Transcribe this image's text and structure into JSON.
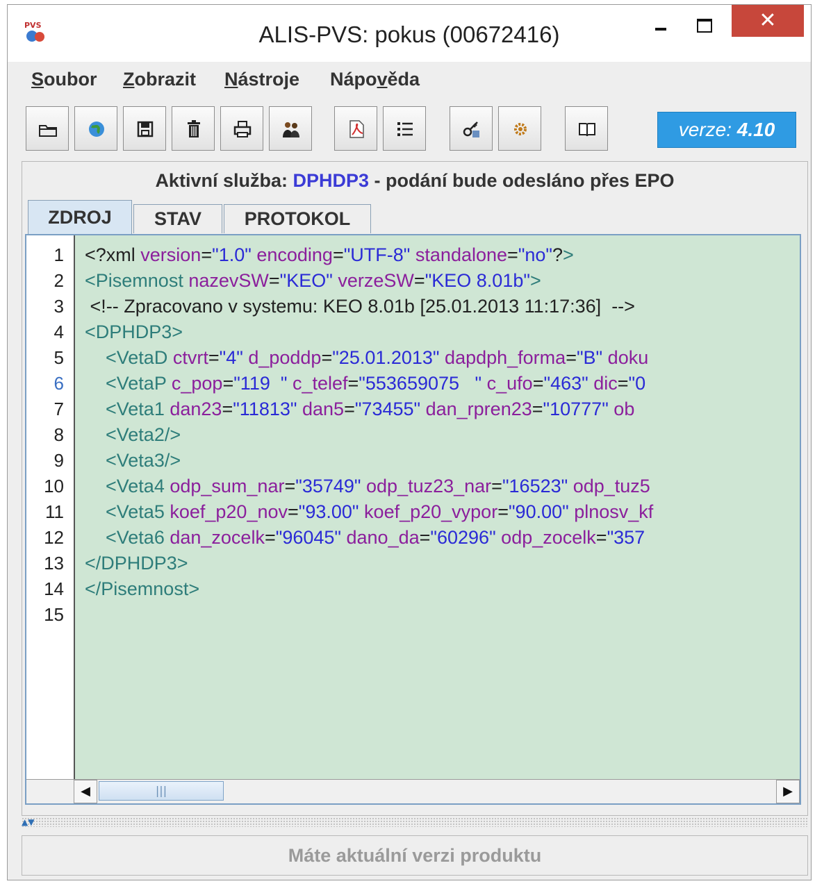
{
  "window": {
    "title": "ALIS-PVS: pokus (00672416)",
    "close_glyph": "✕"
  },
  "menu": [
    {
      "accel": "S",
      "rest": "oubor"
    },
    {
      "accel": "Z",
      "rest": "obrazit"
    },
    {
      "accel": "N",
      "rest": "ástroje"
    },
    {
      "pre": "Nápo",
      "accel": "v",
      "rest": "ěda"
    }
  ],
  "toolbar": {
    "icons": [
      "open-folder-icon",
      "globe-icon",
      "save-icon",
      "trash-icon",
      "print-icon",
      "users-icon",
      "pdf-icon",
      "list-icon",
      "sign-icon",
      "settings-icon",
      "manual-book-icon"
    ],
    "version_label": "verze: ",
    "version_number": "4.10"
  },
  "service": {
    "prefix": "Aktivní služba: ",
    "code": "DPHDP3",
    "suffix": " - podání bude odesláno přes EPO"
  },
  "tabs": [
    {
      "label": "ZDROJ",
      "active": true
    },
    {
      "label": "STAV",
      "active": false
    },
    {
      "label": "PROTOKOL",
      "active": false
    }
  ],
  "editor": {
    "current_line": 6,
    "line_numbers": [
      "1",
      "2",
      "3",
      "4",
      "5",
      "6",
      "7",
      "8",
      "9",
      "10",
      "11",
      "12",
      "13",
      "14",
      "15"
    ],
    "lines": [
      [
        [
          "txt",
          "<?xml "
        ],
        [
          "attr",
          "version"
        ],
        [
          "txt",
          "="
        ],
        [
          "val",
          "\"1.0\""
        ],
        [
          "txt",
          " "
        ],
        [
          "attr",
          "encoding"
        ],
        [
          "txt",
          "="
        ],
        [
          "val",
          "\"UTF-8\""
        ],
        [
          "txt",
          " "
        ],
        [
          "attr",
          "standalone"
        ],
        [
          "txt",
          "="
        ],
        [
          "val",
          "\"no\""
        ],
        [
          "txt",
          "?"
        ],
        [
          "tag",
          ">"
        ]
      ],
      [
        [
          "tag",
          "<Pisemnost "
        ],
        [
          "attr",
          "nazevSW"
        ],
        [
          "txt",
          "="
        ],
        [
          "val",
          "\"KEO\""
        ],
        [
          "txt",
          " "
        ],
        [
          "attr",
          "verzeSW"
        ],
        [
          "txt",
          "="
        ],
        [
          "val",
          "\"KEO 8.01b\""
        ],
        [
          "tag",
          ">"
        ]
      ],
      [
        [
          "txt",
          " <!-- Zpracovano v systemu: KEO 8.01b [25.01.2013 11:17:36]  -->"
        ]
      ],
      [
        [
          "tag",
          "<DPHDP3>"
        ]
      ],
      [
        [
          "tag",
          "    <VetaD "
        ],
        [
          "attr",
          "ctvrt"
        ],
        [
          "txt",
          "="
        ],
        [
          "val",
          "\"4\""
        ],
        [
          "txt",
          " "
        ],
        [
          "attr",
          "d_poddp"
        ],
        [
          "txt",
          "="
        ],
        [
          "val",
          "\"25.01.2013\""
        ],
        [
          "txt",
          " "
        ],
        [
          "attr",
          "dapdph_forma"
        ],
        [
          "txt",
          "="
        ],
        [
          "val",
          "\"B\""
        ],
        [
          "txt",
          " "
        ],
        [
          "attr",
          "doku"
        ]
      ],
      [
        [
          "tag",
          "    <VetaP "
        ],
        [
          "attr",
          "c_pop"
        ],
        [
          "txt",
          "="
        ],
        [
          "val",
          "\"119  \""
        ],
        [
          "txt",
          " "
        ],
        [
          "attr",
          "c_telef"
        ],
        [
          "txt",
          "="
        ],
        [
          "val",
          "\"553659075   \""
        ],
        [
          "txt",
          " "
        ],
        [
          "attr",
          "c_ufo"
        ],
        [
          "txt",
          "="
        ],
        [
          "val",
          "\"463\""
        ],
        [
          "txt",
          " "
        ],
        [
          "attr",
          "dic"
        ],
        [
          "txt",
          "="
        ],
        [
          "val",
          "\"0"
        ]
      ],
      [
        [
          "tag",
          "    <Veta1 "
        ],
        [
          "attr",
          "dan23"
        ],
        [
          "txt",
          "="
        ],
        [
          "val",
          "\"11813\""
        ],
        [
          "txt",
          " "
        ],
        [
          "attr",
          "dan5"
        ],
        [
          "txt",
          "="
        ],
        [
          "val",
          "\"73455\""
        ],
        [
          "txt",
          " "
        ],
        [
          "attr",
          "dan_rpren23"
        ],
        [
          "txt",
          "="
        ],
        [
          "val",
          "\"10777\""
        ],
        [
          "txt",
          " "
        ],
        [
          "attr",
          "ob"
        ]
      ],
      [
        [
          "tag",
          "    <Veta2/>"
        ]
      ],
      [
        [
          "tag",
          "    <Veta3/>"
        ]
      ],
      [
        [
          "tag",
          "    <Veta4 "
        ],
        [
          "attr",
          "odp_sum_nar"
        ],
        [
          "txt",
          "="
        ],
        [
          "val",
          "\"35749\""
        ],
        [
          "txt",
          " "
        ],
        [
          "attr",
          "odp_tuz23_nar"
        ],
        [
          "txt",
          "="
        ],
        [
          "val",
          "\"16523\""
        ],
        [
          "txt",
          " "
        ],
        [
          "attr",
          "odp_tuz5"
        ]
      ],
      [
        [
          "tag",
          "    <Veta5 "
        ],
        [
          "attr",
          "koef_p20_nov"
        ],
        [
          "txt",
          "="
        ],
        [
          "val",
          "\"93.00\""
        ],
        [
          "txt",
          " "
        ],
        [
          "attr",
          "koef_p20_vypor"
        ],
        [
          "txt",
          "="
        ],
        [
          "val",
          "\"90.00\""
        ],
        [
          "txt",
          " "
        ],
        [
          "attr",
          "plnosv_kf"
        ]
      ],
      [
        [
          "tag",
          "    <Veta6 "
        ],
        [
          "attr",
          "dan_zocelk"
        ],
        [
          "txt",
          "="
        ],
        [
          "val",
          "\"96045\""
        ],
        [
          "txt",
          " "
        ],
        [
          "attr",
          "dano_da"
        ],
        [
          "txt",
          "="
        ],
        [
          "val",
          "\"60296\""
        ],
        [
          "txt",
          " "
        ],
        [
          "attr",
          "odp_zocelk"
        ],
        [
          "txt",
          "="
        ],
        [
          "val",
          "\"357"
        ]
      ],
      [
        [
          "tag",
          "</DPHDP3>"
        ]
      ],
      [
        [
          "tag",
          "</Pisemnost>"
        ]
      ],
      []
    ]
  },
  "status": {
    "message": "Máte aktuální verzi produktu"
  }
}
